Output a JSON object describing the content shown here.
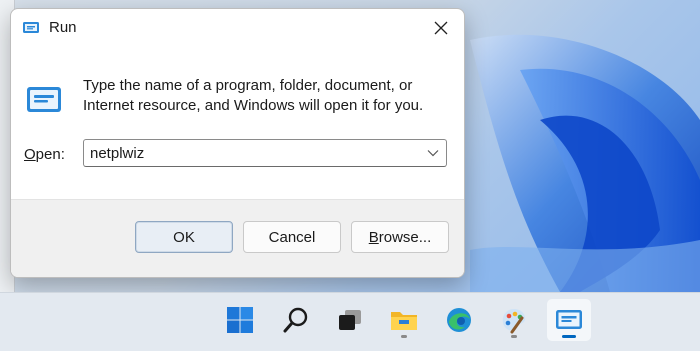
{
  "dialog": {
    "title": "Run",
    "description": "Type the name of a program, folder, document, or Internet resource, and Windows will open it for you.",
    "open_label_prefix": "",
    "open_label_mnemonic": "O",
    "open_label_suffix": "pen:",
    "command_value": "netplwiz",
    "buttons": {
      "ok": "OK",
      "cancel": "Cancel",
      "browse_mnemonic": "B",
      "browse_rest": "rowse..."
    },
    "icons": {
      "title": "run-icon",
      "close": "close-icon",
      "body": "run-icon",
      "dropdown": "chevron-down-icon"
    }
  },
  "taskbar": {
    "items": [
      {
        "name": "start",
        "icon": "windows-logo-icon"
      },
      {
        "name": "search",
        "icon": "search-icon"
      },
      {
        "name": "task-view",
        "icon": "task-view-icon"
      },
      {
        "name": "file-explorer",
        "icon": "folder-icon"
      },
      {
        "name": "edge",
        "icon": "edge-icon"
      },
      {
        "name": "paint",
        "icon": "paint-icon"
      },
      {
        "name": "run",
        "icon": "run-icon"
      }
    ]
  },
  "colors": {
    "accent": "#0067c0",
    "dialog_bg": "#ffffff",
    "footer_bg": "#f0f0f0",
    "taskbar_bg": "#e3e9f0"
  }
}
